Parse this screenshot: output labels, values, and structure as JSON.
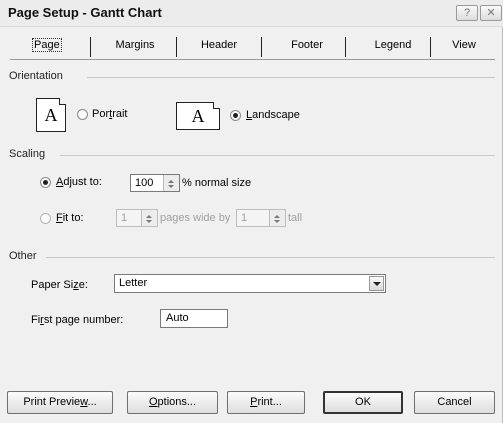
{
  "window": {
    "title": "Page Setup - Gantt Chart",
    "help_glyph": "?",
    "close_glyph": "✕"
  },
  "tabs": [
    {
      "label": "Page",
      "active": true
    },
    {
      "label": "Margins"
    },
    {
      "label": "Header"
    },
    {
      "label": "Footer"
    },
    {
      "label": "Legend"
    },
    {
      "label": "View"
    }
  ],
  "orientation": {
    "title": "Orientation",
    "icon_glyph": "A",
    "portrait_pre": "Por",
    "portrait_u": "t",
    "portrait_post": "rait",
    "landscape_u": "L",
    "landscape_post": "andscape",
    "selected": "Landscape"
  },
  "scaling": {
    "title": "Scaling",
    "adjust_u": "A",
    "adjust_post": "djust to:",
    "adjust_value": "100",
    "adjust_suffix": "% normal size",
    "fit_u": "F",
    "fit_post": "it to:",
    "wide_value": "1",
    "wide_label": "pages wide by",
    "tall_value": "1",
    "tall_label": "tall",
    "selected": "Adjust to"
  },
  "other": {
    "title": "Other",
    "paper_pre": "Paper Si",
    "paper_u": "z",
    "paper_post": "e:",
    "paper_value": "Letter",
    "first_pre": "Fi",
    "first_u": "r",
    "first_post": "st page number:",
    "first_value": "Auto"
  },
  "buttons": {
    "preview_pre": "Print Previe",
    "preview_u": "w",
    "preview_post": "...",
    "options_u": "O",
    "options_post": "ptions...",
    "print_u": "P",
    "print_post": "rint...",
    "ok": "OK",
    "cancel": "Cancel"
  }
}
